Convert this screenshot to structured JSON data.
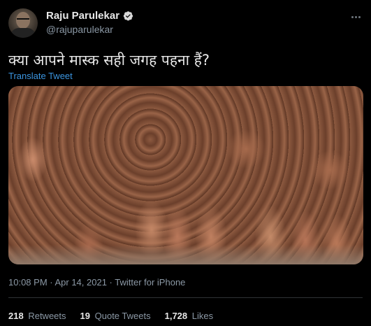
{
  "author": {
    "name": "Raju Parulekar",
    "handle": "@rajuparulekar",
    "verified": true
  },
  "tweet": {
    "text": "क्या आपने मास्क सही जगह पहना हैं?",
    "translate_label": "Translate Tweet",
    "timestamp": "10:08 PM · Apr 14, 2021 · Twitter for iPhone"
  },
  "stats": {
    "retweets": {
      "count": "218",
      "label": "Retweets"
    },
    "quote_tweets": {
      "count": "19",
      "label": "Quote Tweets"
    },
    "likes": {
      "count": "1,728",
      "label": "Likes"
    }
  },
  "colors": {
    "background": "#000000",
    "link": "#3b95e0",
    "secondary_text": "#8b98a5",
    "verified_badge": "#1d9bf0"
  }
}
